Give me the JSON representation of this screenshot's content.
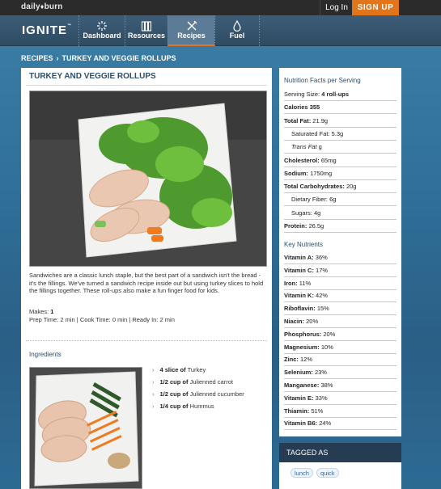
{
  "topbar": {
    "brand": "daily",
    "brand2": "burn",
    "login": "Log In",
    "signup": "SIGN UP"
  },
  "nav": {
    "logo": "IGNITE",
    "items": [
      {
        "label": "Dashboard",
        "icon": "sunburst-icon",
        "active": false
      },
      {
        "label": "Resources",
        "icon": "books-icon",
        "active": false
      },
      {
        "label": "Recipes",
        "icon": "utensils-icon",
        "active": true
      },
      {
        "label": "Fuel",
        "icon": "fuel-drop-icon",
        "active": false
      }
    ]
  },
  "breadcrumb": {
    "root": "RECIPES",
    "sep": "›",
    "current": "TURKEY AND VEGGIE ROLLUPS"
  },
  "recipe": {
    "title": "TURKEY AND VEGGIE ROLLUPS",
    "description": "Sandwiches are a classic lunch staple, but the best part of a sandwich isn't the bread - it's the fillings. We've turned a sandwich recipe inside out but using turkey slices to hold the fillings together. These roll-ups also make a fun finger food for kids.",
    "makes_label": "Makes:",
    "makes": "1",
    "prep_label": "Prep Time:",
    "prep": "2 min",
    "cook_label": "Cook Time:",
    "cook": "0 min",
    "ready_label": "Ready In:",
    "ready": "2 min",
    "ingredients_title": "Ingredients",
    "ingredients": [
      {
        "qty": "4 slice of",
        "name": "Turkey"
      },
      {
        "qty": "1/2 cup of",
        "name": "Julienned carrot"
      },
      {
        "qty": "1/2 cup of",
        "name": "Julienned cucumber"
      },
      {
        "qty": "1/4 cup of",
        "name": "Hummus"
      }
    ]
  },
  "nutrition": {
    "title": "Nutrition Facts per Serving",
    "facts": [
      {
        "label": "Serving Size:",
        "value": "4 roll-ups",
        "bold_label": false,
        "bold_value": true,
        "indent": false
      },
      {
        "label": "Calories",
        "value": "355",
        "bold_label": true,
        "bold_value": true,
        "indent": false
      },
      {
        "label": "Total Fat:",
        "value": "21.9g",
        "bold_label": true,
        "bold_value": false,
        "indent": false
      },
      {
        "label": "Saturated Fat:",
        "value": "5.3g",
        "bold_label": false,
        "bold_value": false,
        "indent": true
      },
      {
        "label": "Trans Fat",
        "value": "g",
        "bold_label": false,
        "bold_value": false,
        "indent": true,
        "italic": true
      },
      {
        "label": "Cholesterol:",
        "value": "65mg",
        "bold_label": true,
        "bold_value": false,
        "indent": false
      },
      {
        "label": "Sodium:",
        "value": "1750mg",
        "bold_label": true,
        "bold_value": false,
        "indent": false
      },
      {
        "label": "Total Carbohydrates:",
        "value": "20g",
        "bold_label": true,
        "bold_value": false,
        "indent": false
      },
      {
        "label": "Dietary Fiber:",
        "value": "6g",
        "bold_label": false,
        "bold_value": false,
        "indent": true
      },
      {
        "label": "Sugars:",
        "value": "4g",
        "bold_label": false,
        "bold_value": false,
        "indent": true
      },
      {
        "label": "Protein:",
        "value": "26.5g",
        "bold_label": true,
        "bold_value": false,
        "indent": false
      }
    ],
    "key_title": "Key Nutrients",
    "key": [
      {
        "label": "Vitamin A:",
        "value": "36%"
      },
      {
        "label": "Vitamin C:",
        "value": "17%"
      },
      {
        "label": "Iron:",
        "value": "11%"
      },
      {
        "label": "Vitamin K:",
        "value": "42%"
      },
      {
        "label": "Riboflavin:",
        "value": "15%"
      },
      {
        "label": "Niacin:",
        "value": "20%"
      },
      {
        "label": "Phosphorus:",
        "value": "20%"
      },
      {
        "label": "Magnesium:",
        "value": "10%"
      },
      {
        "label": "Zinc:",
        "value": "12%"
      },
      {
        "label": "Selenium:",
        "value": "23%"
      },
      {
        "label": "Manganese:",
        "value": "38%"
      },
      {
        "label": "Vitamin E:",
        "value": "33%"
      },
      {
        "label": "Thiamin:",
        "value": "51%"
      },
      {
        "label": "Vitamin B6:",
        "value": "24%"
      }
    ]
  },
  "tags": {
    "title": "TAGGED AS",
    "items": [
      "lunch",
      "quick"
    ]
  },
  "colors": {
    "accent": "#e2741b",
    "title_blue": "#2b4e6e",
    "link": "#2e6da4"
  }
}
